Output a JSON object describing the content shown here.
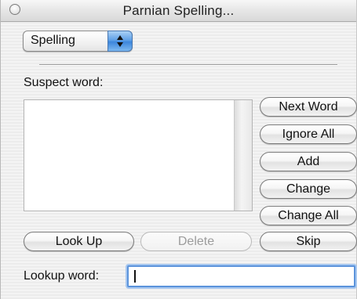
{
  "window": {
    "title": "Parnian Spelling..."
  },
  "mode_popup": {
    "selected": "Spelling"
  },
  "suspect": {
    "label": "Suspect word:",
    "items": []
  },
  "buttons": {
    "next_word": "Next Word",
    "ignore_all": "Ignore All",
    "add": "Add",
    "change": "Change",
    "change_all": "Change All",
    "look_up": "Look Up",
    "delete": "Delete",
    "skip": "Skip"
  },
  "lookup": {
    "label": "Lookup word:",
    "value": ""
  },
  "colors": {
    "focus_ring": "#5b93db",
    "popup_arrow_blue": "#3d86dc"
  }
}
